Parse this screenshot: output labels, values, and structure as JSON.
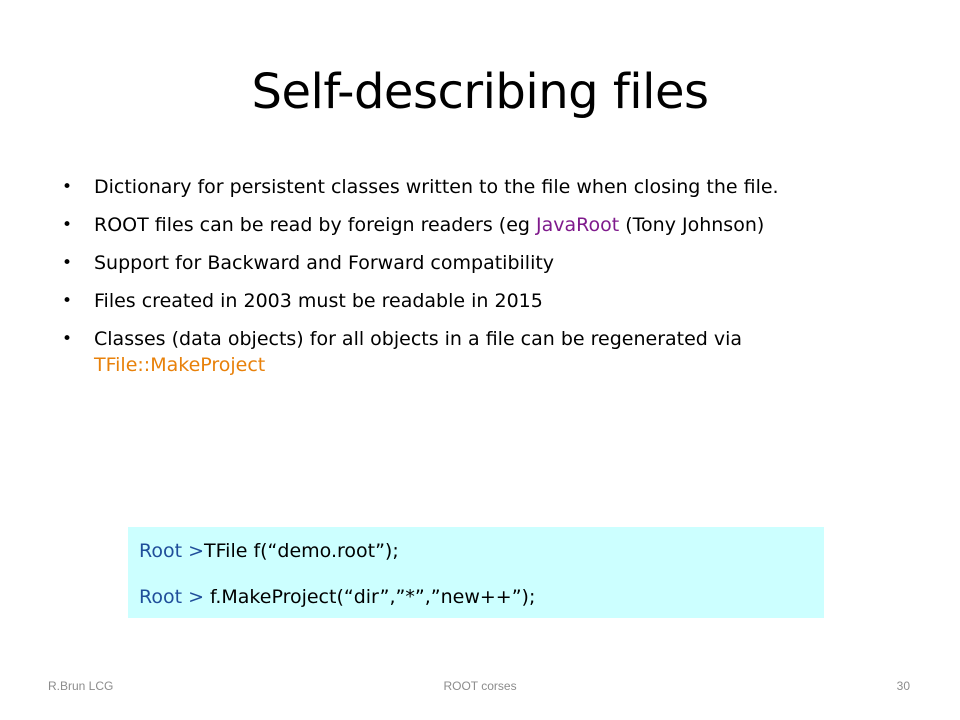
{
  "slide": {
    "title": "Self-describing files"
  },
  "bullets": [
    {
      "parts": [
        {
          "text": "Dictionary for persistent classes written to the file when closing the file.",
          "style": "normal"
        }
      ]
    },
    {
      "parts": [
        {
          "text": "ROOT files can be read by foreign readers (eg ",
          "style": "normal"
        },
        {
          "text": "JavaRoot",
          "style": "purple"
        },
        {
          "text": " (Tony Johnson)",
          "style": "normal"
        }
      ]
    },
    {
      "parts": [
        {
          "text": "Support for Backward and Forward compatibility",
          "style": "normal"
        }
      ]
    },
    {
      "parts": [
        {
          "text": "Files created in 2003 must be readable in 2015",
          "style": "normal"
        }
      ]
    },
    {
      "parts": [
        {
          "text": "Classes (data objects) for all objects in a file can be regenerated via ",
          "style": "normal"
        },
        {
          "text": "TFile::MakeProject",
          "style": "orange"
        }
      ]
    }
  ],
  "code": {
    "line1_prompt": "Root >",
    "line1_code": "TFile f(“demo.root”);",
    "line2_prompt": "Root > ",
    "line2_code": "f.MakeProject(“dir”,”*”,”new++”);"
  },
  "footer": {
    "left": "R.Brun LCG",
    "center": "ROOT corses",
    "right": "30"
  },
  "colors": {
    "code_background": "#ccffff",
    "highlight_purple": "#7f1a8c",
    "highlight_orange": "#e8810a",
    "prompt_blue": "#1f4e9a",
    "footer_gray": "#8c8c8c"
  }
}
